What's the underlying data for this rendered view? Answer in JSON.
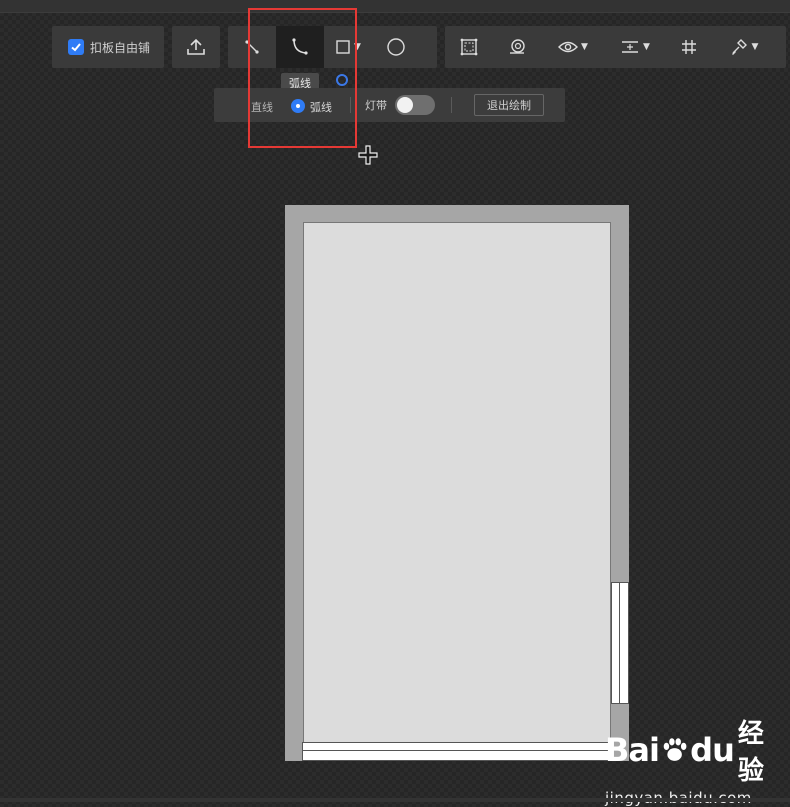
{
  "toolbar": {
    "snap_checkbox_label": "扣板自由铺",
    "snap_checked": true,
    "arc_tooltip": "弧线"
  },
  "subbar": {
    "straight_label": "直线",
    "arc_label": "弧线",
    "arc_selected": true,
    "light_strip_label": "灯带",
    "light_strip_on": false,
    "exit_label": "退出绘制"
  },
  "icons": {
    "export": "upload-icon",
    "polyline": "polyline-icon",
    "arc": "arc-icon",
    "rectangle": "rectangle-icon",
    "circle": "circle-icon",
    "region": "region-icon",
    "pattern": "pattern-icon",
    "view": "eye-icon",
    "align": "align-icon",
    "grid": "grid-icon",
    "brush": "brush-icon"
  },
  "watermark": {
    "logo_left": "Bai",
    "logo_right": "du",
    "logo_cn": "经验",
    "url": "jingyan.baidu.com"
  },
  "colors": {
    "accent": "#2f7cf6",
    "highlight": "#e53935",
    "canvas_bg": "#262626",
    "floor": "#dcdcdc",
    "wall": "#a6a6a6"
  }
}
